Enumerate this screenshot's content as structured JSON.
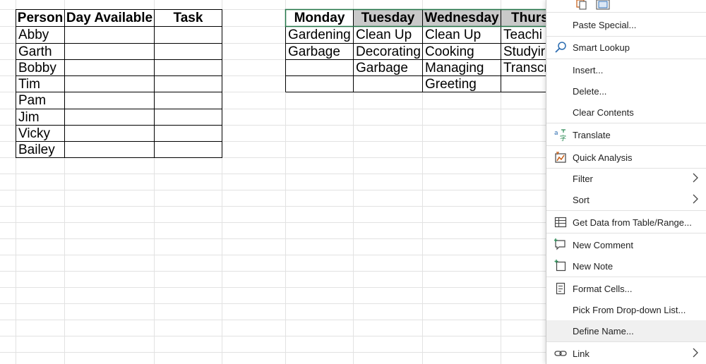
{
  "left_table": {
    "headers": [
      "Person",
      "Day Available",
      "Task"
    ],
    "people": [
      "Abby",
      "Garth",
      "Bobby",
      "Tim",
      "Pam",
      "Jim",
      "Vicky",
      "Bailey"
    ]
  },
  "schedule_table": {
    "headers": [
      "Monday",
      "Tuesday",
      "Wednesday",
      "Thurs"
    ],
    "rows": [
      [
        "Gardening",
        "Clean Up",
        "Clean Up",
        "Teachi"
      ],
      [
        "Garbage",
        "Decorating",
        "Cooking",
        "Studyir"
      ],
      [
        "",
        "Garbage",
        "Managing",
        "Transcr"
      ],
      [
        "",
        "",
        "Greeting",
        ""
      ]
    ]
  },
  "context_menu": {
    "items": [
      {
        "label": "Paste Special...",
        "icon": "none"
      },
      {
        "label": "Smart Lookup",
        "icon": "search-icon"
      },
      {
        "label": "Insert...",
        "icon": "none"
      },
      {
        "label": "Delete...",
        "icon": "none"
      },
      {
        "label": "Clear Contents",
        "icon": "none"
      },
      {
        "label": "Translate",
        "icon": "translate-icon"
      },
      {
        "label": "Quick Analysis",
        "icon": "quick-analysis-icon"
      },
      {
        "label": "Filter",
        "icon": "none",
        "submenu": true
      },
      {
        "label": "Sort",
        "icon": "none",
        "submenu": true
      },
      {
        "label": "Get Data from Table/Range...",
        "icon": "table-icon"
      },
      {
        "label": "New Comment",
        "icon": "comment-icon"
      },
      {
        "label": "New Note",
        "icon": "note-icon"
      },
      {
        "label": "Format Cells...",
        "icon": "format-cells-icon"
      },
      {
        "label": "Pick From Drop-down List...",
        "icon": "none"
      },
      {
        "label": "Define Name...",
        "icon": "none",
        "highlighted": true
      },
      {
        "label": "Link",
        "icon": "link-icon",
        "submenu": true
      }
    ]
  }
}
